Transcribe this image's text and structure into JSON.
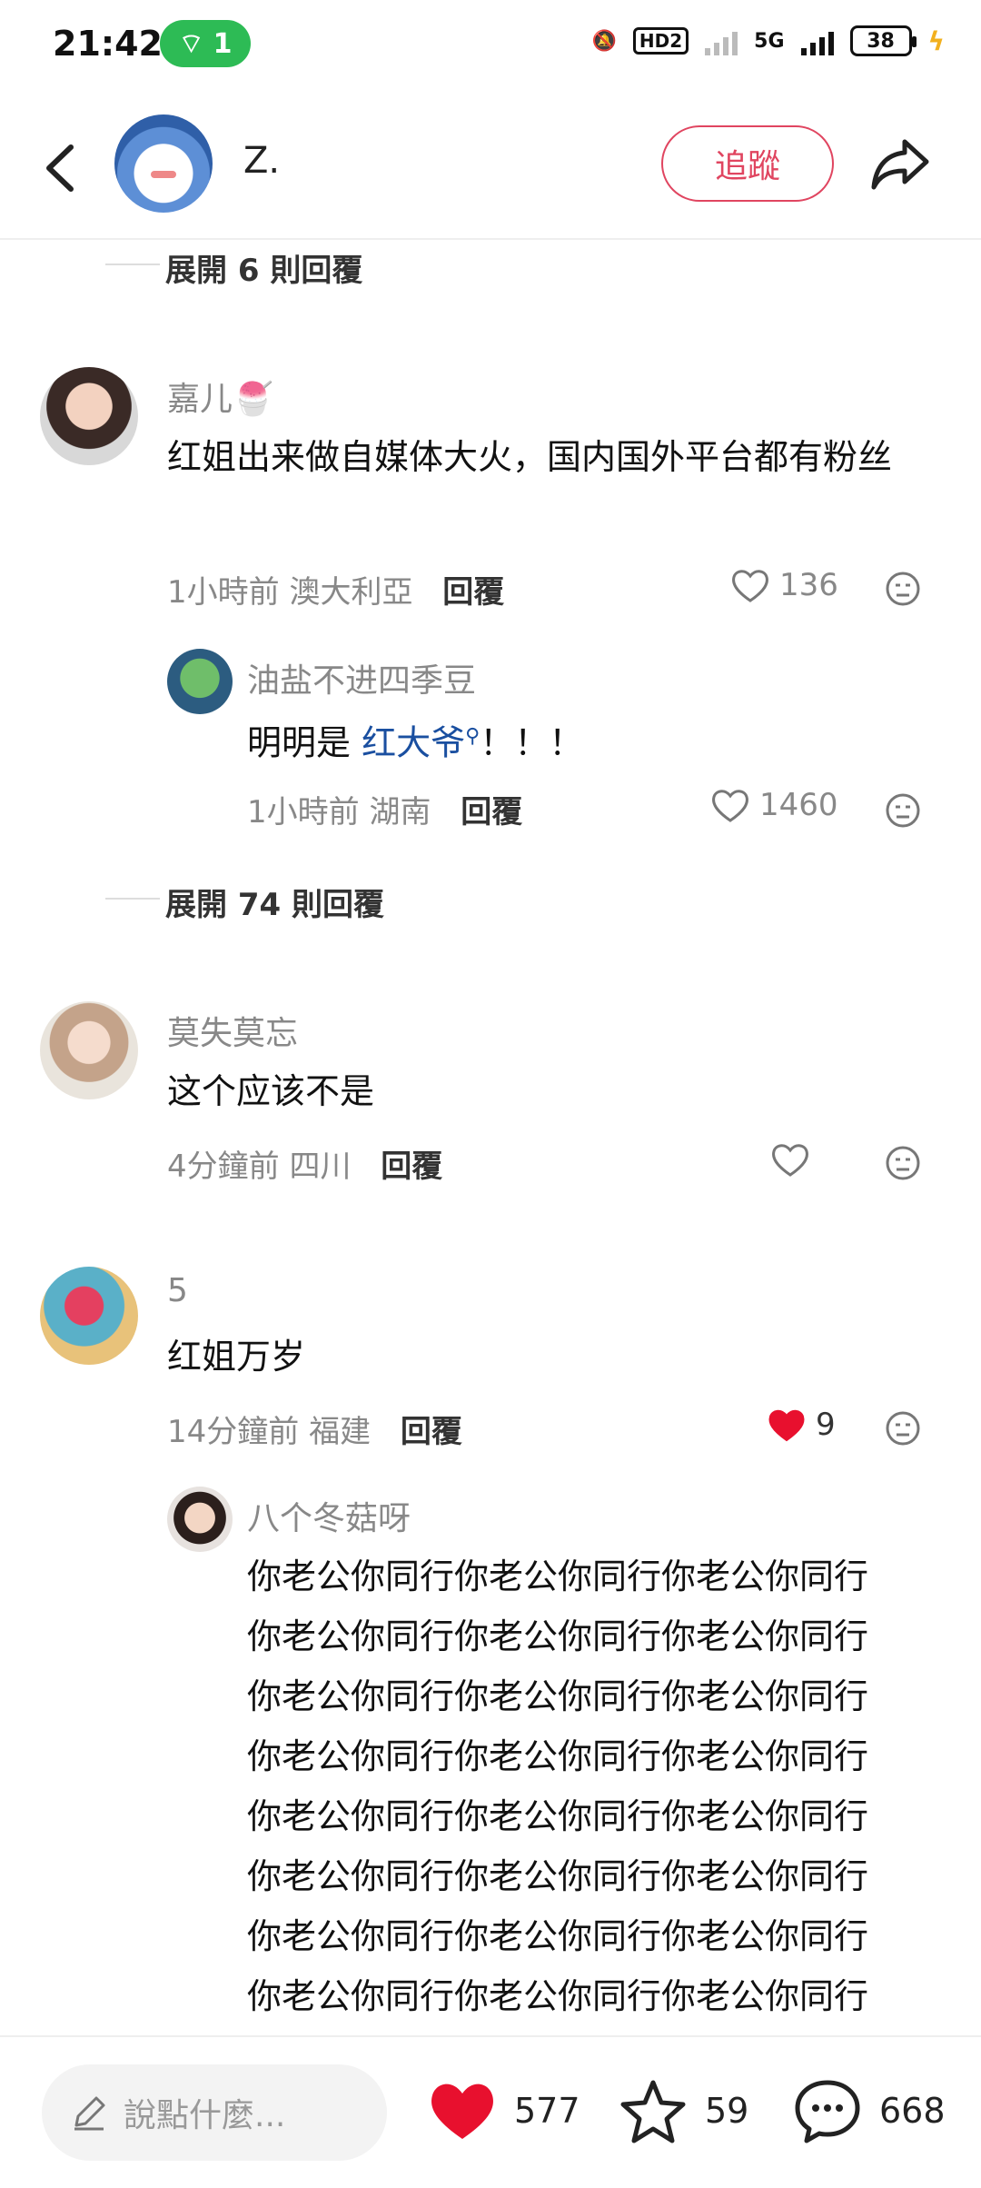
{
  "status_bar": {
    "time": "21:42",
    "hotspot_count": "1",
    "hd_label": "HD2",
    "network": "5G",
    "battery": "38"
  },
  "header": {
    "username": "Z.",
    "follow_label": "追蹤"
  },
  "expand_replies_1": "展開 6 則回覆",
  "expand_replies_2": "展開 74 則回覆",
  "comments": [
    {
      "name": "嘉儿🍧",
      "text": "红姐出来做自媒体大火，国内国外平台都有粉丝",
      "time": "1小時前",
      "location": "澳大利亞",
      "reply_label": "回覆",
      "likes": "136",
      "replies": [
        {
          "name": "油盐不进四季豆",
          "text_prefix": "明明是 ",
          "text_link": "红大爷",
          "text_suffix": "！！！",
          "time": "1小時前",
          "location": "湖南",
          "reply_label": "回覆",
          "likes": "1460"
        }
      ]
    },
    {
      "name": "莫失莫忘",
      "text": "这个应该不是",
      "time": "4分鐘前",
      "location": "四川",
      "reply_label": "回覆",
      "likes": ""
    },
    {
      "name": "5",
      "text": "红姐万岁",
      "time": "14分鐘前",
      "location": "福建",
      "reply_label": "回覆",
      "likes": "9",
      "liked": true,
      "replies": [
        {
          "name": "八个冬菇呀",
          "lines": [
            "你老公你同行你老公你同行你老公你同行",
            "你老公你同行你老公你同行你老公你同行",
            "你老公你同行你老公你同行你老公你同行",
            "你老公你同行你老公你同行你老公你同行",
            "你老公你同行你老公你同行你老公你同行",
            "你老公你同行你老公你同行你老公你同行",
            "你老公你同行你老公你同行你老公你同行",
            "你老公你同行你老公你同行你老公你同行"
          ]
        }
      ]
    }
  ],
  "bottom_bar": {
    "input_placeholder": "說點什麼...",
    "likes": "577",
    "favorites": "59",
    "comments": "668"
  },
  "colors": {
    "accent": "#e04560",
    "like_red": "#e8102e",
    "link": "#1a4fa0"
  }
}
